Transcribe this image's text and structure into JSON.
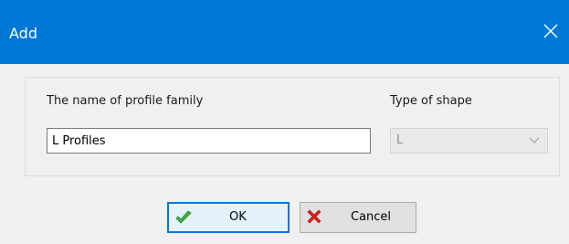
{
  "window": {
    "title": "Add",
    "close_glyph": "✕"
  },
  "form": {
    "name_label": "The name of profile family",
    "name_value": "L Profiles",
    "type_label": "Type of shape",
    "type_value": "L"
  },
  "buttons": {
    "ok_label": "OK",
    "cancel_label": "Cancel"
  },
  "icons": {
    "ok": "check-icon",
    "cancel": "x-mark-icon",
    "select": "chevron-down-icon",
    "close": "close-icon"
  },
  "colors": {
    "titlebar": "#0078d7",
    "ok_check": "#3cb43c",
    "cancel_x": "#e01e1e"
  }
}
